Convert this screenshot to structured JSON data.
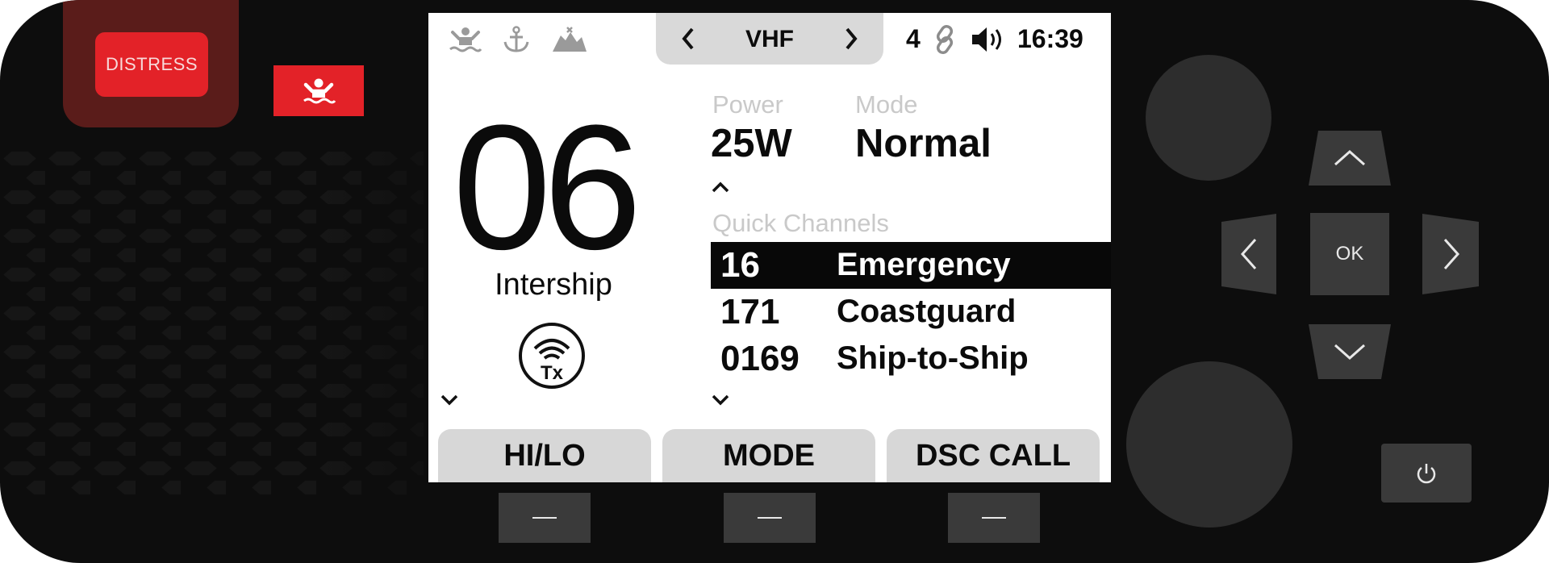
{
  "device": {
    "distress_label": "DISTRESS",
    "mob_icon": "man-overboard-icon",
    "ok_label": "OK",
    "power_icon": "power-icon"
  },
  "screen": {
    "status_icons": [
      "man-overboard-icon",
      "anchor-icon",
      "shoal-icon"
    ],
    "band": "VHF",
    "link_count": "4",
    "link_icon": "link-icon",
    "volume_icon": "speaker-icon",
    "time": "16:39",
    "channel": "06",
    "channel_name": "Intership",
    "tx_icon": "tx-icon",
    "power_label": "Power",
    "power_value": "25W",
    "mode_label": "Mode",
    "mode_value": "Normal",
    "quick_channels_label": "Quick Channels",
    "quick_channels": [
      {
        "number": "16",
        "name": "Emergency",
        "selected": true
      },
      {
        "number": "171",
        "name": "Coastguard",
        "selected": false
      },
      {
        "number": "0169",
        "name": "Ship-to-Ship",
        "selected": false
      }
    ],
    "softkeys": [
      "HI/LO",
      "MODE",
      "DSC CALL"
    ]
  },
  "colors": {
    "distress_red": "#e32228",
    "body": "#0d0d0d",
    "key_grey": "#3a3a3a",
    "softkey_grey": "#d7d7d7"
  }
}
